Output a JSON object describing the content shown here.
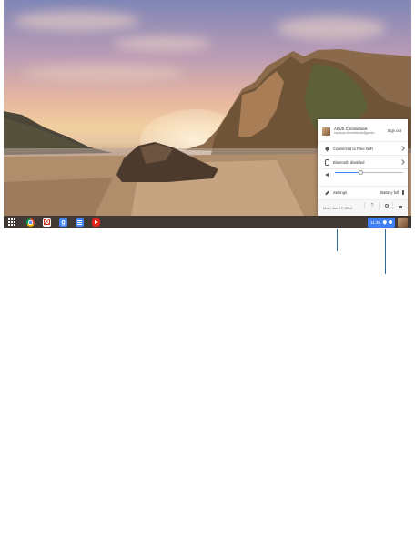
{
  "tray_popup": {
    "account_name": "ASUS Chromebook",
    "account_email": "my.asus.chromebook@gmail...",
    "sign_out_label": "Sign out",
    "wifi_label": "Connected to Free WiFi",
    "bluetooth_label": "Bluetooth disabled",
    "volume_level": 0.38,
    "settings_label": "Settings",
    "battery_label": "Battery full",
    "date_label": "Mon, Jan 27, 2014"
  },
  "shelf": {
    "apps": [
      "chrome-icon",
      "gmail-icon",
      "google-search-icon",
      "docs-icon",
      "youtube-icon"
    ],
    "status_time": "11:35"
  },
  "colors": {
    "shelf_background": "#28282c",
    "status_tray_accent": "#3d7ff3",
    "callout_line": "#2d6b94"
  }
}
